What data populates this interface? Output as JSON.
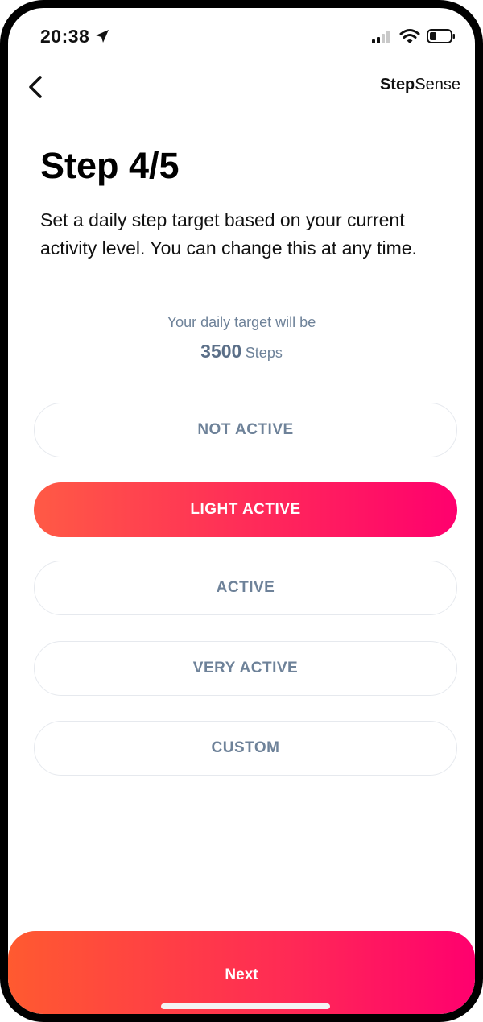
{
  "status_bar": {
    "time": "20:38"
  },
  "header": {
    "brand_bold": "Step",
    "brand_regular": "Sense"
  },
  "main": {
    "title": "Step 4/5",
    "description": "Set a daily step target based on your current activity level. You can change this at any time.",
    "target_label": "Your daily target will be",
    "target_value": "3500",
    "target_unit": "Steps"
  },
  "options": [
    {
      "label": "NOT ACTIVE",
      "selected": false
    },
    {
      "label": "LIGHT ACTIVE",
      "selected": true
    },
    {
      "label": "ACTIVE",
      "selected": false
    },
    {
      "label": "VERY ACTIVE",
      "selected": false
    },
    {
      "label": "CUSTOM",
      "selected": false
    }
  ],
  "footer": {
    "next_label": "Next"
  },
  "colors": {
    "accent_start": "#ff5a45",
    "accent_end": "#ff006e",
    "muted_text": "#6e8299"
  }
}
